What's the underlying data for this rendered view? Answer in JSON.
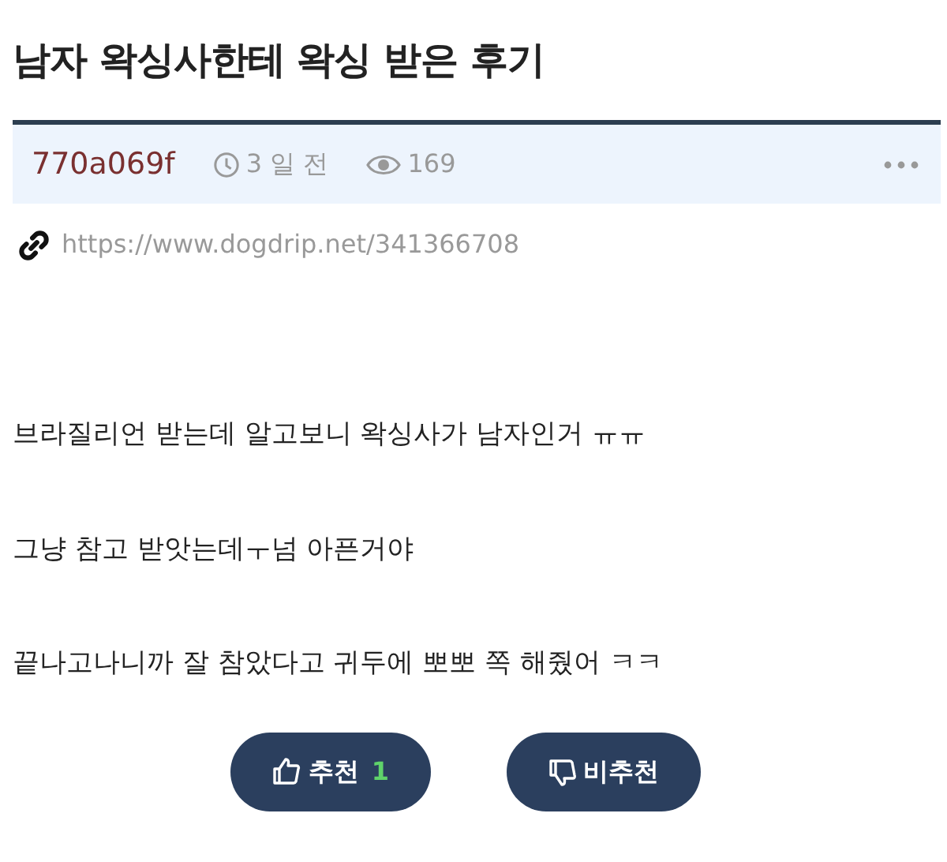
{
  "title": "남자 왁싱사한테 왁싱 받은 후기",
  "meta": {
    "author": "770a069f",
    "time": "3 일 전",
    "views": "169"
  },
  "url": "https://www.dogdrip.net/341366708",
  "paragraphs": [
    "브라질리언 받는데 알고보니 왁싱사가 남자인거 ㅠㅠ",
    "그냥 참고 받앗는데ㅜ넘 아픈거야",
    "끝나고나니까 잘 참았다고 귀두에 뽀뽀 쪽 해줬어 ㅋㅋ"
  ],
  "votes": [
    {
      "kind": "up",
      "label": "추천",
      "count": "1"
    },
    {
      "kind": "down",
      "label": "비추천"
    }
  ]
}
